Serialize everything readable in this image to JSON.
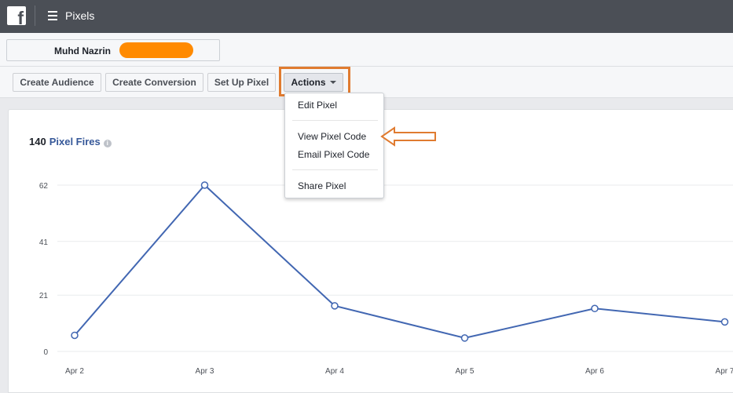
{
  "topbar": {
    "app_title": "Pixels",
    "logo_letter": "f",
    "logo_icon": "facebook-logo-icon",
    "menu_icon": "hamburger-menu-icon"
  },
  "account": {
    "name": "Muhd Nazrin",
    "redaction_color": "#ff8a00"
  },
  "toolbar": {
    "create_audience": "Create Audience",
    "create_conversion": "Create Conversion",
    "set_up_pixel": "Set Up Pixel",
    "actions": "Actions",
    "highlight_color": "#e07b30"
  },
  "dropdown": {
    "items": [
      "Edit Pixel",
      "View Pixel Code",
      "Email Pixel Code",
      "Share Pixel"
    ]
  },
  "stats": {
    "count": "140",
    "label": "Pixel Fires",
    "info_icon": "info-icon"
  },
  "chart_data": {
    "type": "line",
    "title": "",
    "xlabel": "",
    "ylabel": "",
    "categories": [
      "Apr 2",
      "Apr 3",
      "Apr 4",
      "Apr 5",
      "Apr 6",
      "Apr 7"
    ],
    "series": [
      {
        "values": [
          6,
          62,
          17,
          5,
          16,
          11
        ]
      }
    ],
    "ytick_labels": [
      "62",
      "41",
      "21",
      "0"
    ],
    "xtick_labels": [
      "Apr 2",
      "Apr 3",
      "Apr 4",
      "Apr 5",
      "Apr 6",
      "Apr 7"
    ],
    "ylim": [
      0,
      62
    ],
    "grid": true,
    "line_color": "#4267b2"
  }
}
